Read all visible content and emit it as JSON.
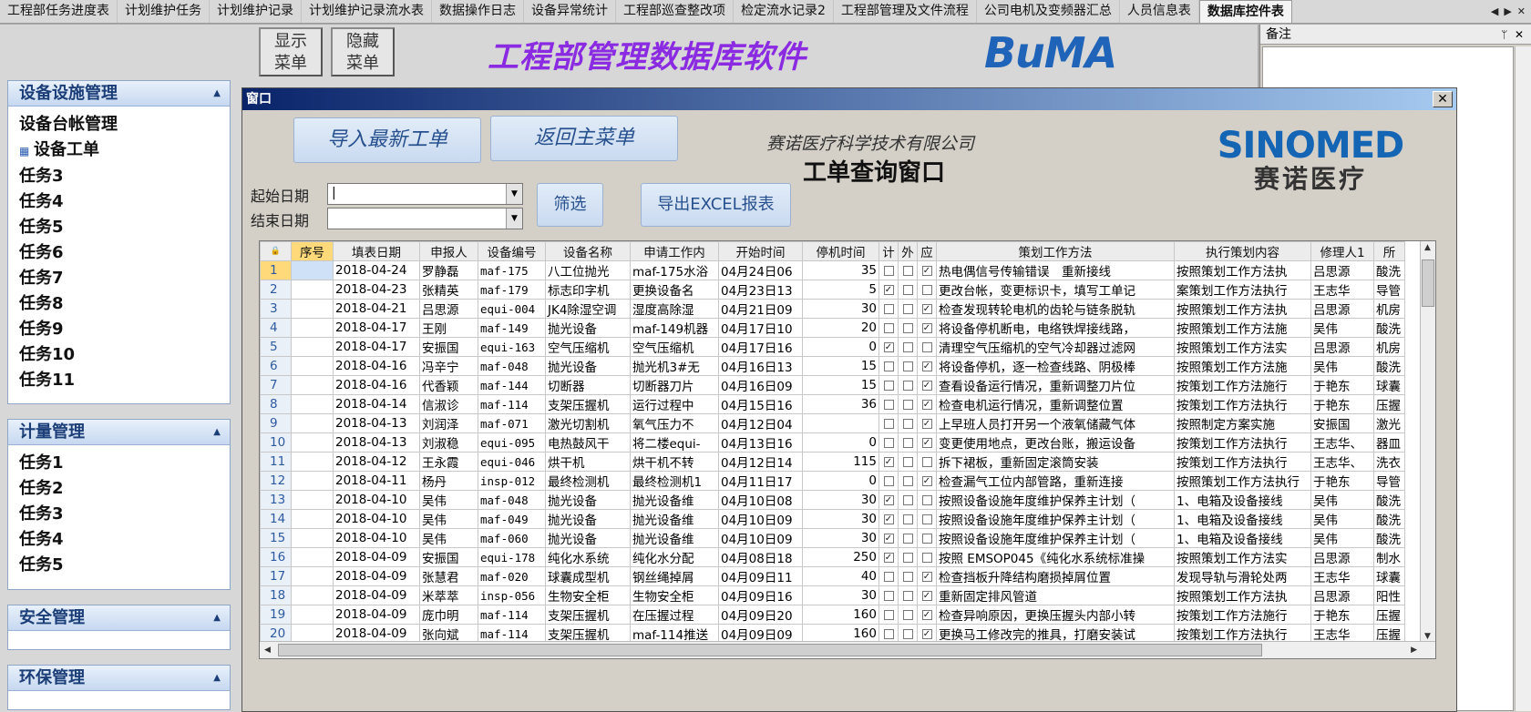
{
  "tabs": [
    {
      "label": "工程部任务进度表",
      "active": false
    },
    {
      "label": "计划维护任务",
      "active": false
    },
    {
      "label": "计划维护记录",
      "active": false
    },
    {
      "label": "计划维护记录流水表",
      "active": false
    },
    {
      "label": "数据操作日志",
      "active": false
    },
    {
      "label": "设备异常统计",
      "active": false
    },
    {
      "label": "工程部巡查整改项",
      "active": false
    },
    {
      "label": "检定流水记录2",
      "active": false
    },
    {
      "label": "工程部管理及文件流程",
      "active": false
    },
    {
      "label": "公司电机及变频器汇总",
      "active": false
    },
    {
      "label": "人员信息表",
      "active": false
    },
    {
      "label": "数据库控件表",
      "active": true
    }
  ],
  "top": {
    "show_menu": "显示\n菜单",
    "hide_menu": "隐藏\n菜单",
    "app_title": "工程部管理数据库软件",
    "buma_logo": "BuMA"
  },
  "sidebar": {
    "groups": [
      {
        "title": "设备设施管理",
        "items": [
          "设备台帐管理",
          "设备工单",
          "任务3",
          "任务4",
          "任务5",
          "任务6",
          "任务7",
          "任务8",
          "任务9",
          "任务10",
          "任务11"
        ]
      },
      {
        "title": "计量管理",
        "items": [
          "任务1",
          "任务2",
          "任务3",
          "任务4",
          "任务5"
        ]
      },
      {
        "title": "安全管理",
        "items": []
      },
      {
        "title": "环保管理",
        "items": []
      }
    ]
  },
  "notes": {
    "title": "备注",
    "pin": "ᛘ",
    "close": "✕"
  },
  "popup": {
    "title": "窗口",
    "close": "✕",
    "import_button": "导入最新工单",
    "back_button": "返回主菜单",
    "company": "赛诺医疗科学技术有限公司",
    "window_title": "工单查询窗口",
    "logo_en": "SINOMED",
    "logo_cn": "赛诺医疗",
    "start_label": "起始日期",
    "end_label": "结束日期",
    "start_value": "|",
    "end_value": "",
    "filter_button": "筛选",
    "export_button": "导出EXCEL报表"
  },
  "grid": {
    "columns": [
      "序号",
      "填表日期",
      "申报人",
      "设备编号",
      "设备名称",
      "申请工作内",
      "开始时间",
      "停机时间",
      "计",
      "外",
      "应",
      "策划工作方法",
      "执行策划内容",
      "修理人1",
      "所"
    ],
    "rows": [
      {
        "n": "1",
        "date": "2018-04-24",
        "person": "罗静磊",
        "code": "maf-175",
        "name": "八工位抛光",
        "req": "maf-175水浴",
        "start": "04月24日06",
        "stop": "35",
        "c1": false,
        "c2": false,
        "c3": true,
        "plan": "热电偶信号传输错误　重新接线",
        "exec": "按照策划工作方法执",
        "rep": "吕思源",
        "loc": "酸洗"
      },
      {
        "n": "2",
        "date": "2018-04-23",
        "person": "张精英",
        "code": "maf-179",
        "name": "标志印字机",
        "req": "更换设备名",
        "start": "04月23日13",
        "stop": "5",
        "c1": true,
        "c2": false,
        "c3": false,
        "plan": "更改台帐，变更标识卡，填写工单记",
        "exec": "案策划工作方法执行",
        "rep": "王志华",
        "loc": "导管"
      },
      {
        "n": "3",
        "date": "2018-04-21",
        "person": "吕思源",
        "code": "equi-004",
        "name": "JK4除湿空调",
        "req": "湿度高除湿",
        "start": "04月21日09",
        "stop": "30",
        "c1": false,
        "c2": false,
        "c3": true,
        "plan": "检查发现转轮电机的齿轮与链条脱轨",
        "exec": "按照策划工作方法执",
        "rep": "吕思源",
        "loc": "机房"
      },
      {
        "n": "4",
        "date": "2018-04-17",
        "person": "王刚",
        "code": "maf-149",
        "name": "抛光设备",
        "req": "maf-149机器",
        "start": "04月17日10",
        "stop": "20",
        "c1": false,
        "c2": false,
        "c3": true,
        "plan": "将设备停机断电，电络铁焊接线路，",
        "exec": "按照策划工作方法施",
        "rep": "吴伟",
        "loc": "酸洗"
      },
      {
        "n": "5",
        "date": "2018-04-17",
        "person": "安振国",
        "code": "equi-163",
        "name": "空气压缩机",
        "req": "空气压缩机",
        "start": "04月17日16",
        "stop": "0",
        "c1": true,
        "c2": false,
        "c3": false,
        "plan": "清理空气压缩机的空气冷却器过滤网",
        "exec": "按照策划工作方法实",
        "rep": "吕思源",
        "loc": "机房"
      },
      {
        "n": "6",
        "date": "2018-04-16",
        "person": "冯辛宁",
        "code": "maf-048",
        "name": "抛光设备",
        "req": "抛光机3#无",
        "start": "04月16日13",
        "stop": "15",
        "c1": false,
        "c2": false,
        "c3": true,
        "plan": "将设备停机，逐一检查线路、阴极棒",
        "exec": "按照策划工作方法施",
        "rep": "吴伟",
        "loc": "酸洗"
      },
      {
        "n": "7",
        "date": "2018-04-16",
        "person": "代香颖",
        "code": "maf-144",
        "name": "切断器",
        "req": "切断器刀片",
        "start": "04月16日09",
        "stop": "15",
        "c1": false,
        "c2": false,
        "c3": true,
        "plan": "查看设备运行情况，重新调整刀片位",
        "exec": "按策划工作方法施行",
        "rep": "于艳东",
        "loc": "球囊"
      },
      {
        "n": "8",
        "date": "2018-04-14",
        "person": "信淑诊",
        "code": "maf-114",
        "name": "支架压握机",
        "req": "运行过程中",
        "start": "04月15日16",
        "stop": "36",
        "c1": false,
        "c2": false,
        "c3": true,
        "plan": "检查电机运行情况，重新调整位置",
        "exec": "按策划工作方法执行",
        "rep": "于艳东",
        "loc": "压握"
      },
      {
        "n": "9",
        "date": "2018-04-13",
        "person": "刘润泽",
        "code": "maf-071",
        "name": "激光切割机",
        "req": "氧气压力不",
        "start": "04月12日04",
        "stop": "",
        "c1": false,
        "c2": false,
        "c3": true,
        "plan": "上早班人员打开另一个液氧储藏气体",
        "exec": "按照制定方案实施",
        "rep": "安振国",
        "loc": "激光"
      },
      {
        "n": "10",
        "date": "2018-04-13",
        "person": "刘淑稳",
        "code": "equi-095",
        "name": "电热鼓风干",
        "req": "将二楼equi-",
        "start": "04月13日16",
        "stop": "0",
        "c1": false,
        "c2": false,
        "c3": true,
        "plan": "变更使用地点，更改台账，搬运设备",
        "exec": "按策划工作方法执行",
        "rep": "王志华、",
        "loc": "器皿"
      },
      {
        "n": "11",
        "date": "2018-04-12",
        "person": "王永霞",
        "code": "equi-046",
        "name": "烘干机",
        "req": "烘干机不转",
        "start": "04月12日14",
        "stop": "115",
        "c1": true,
        "c2": false,
        "c3": false,
        "plan": "拆下裙板，重新固定滚筒安装",
        "exec": "按策划工作方法执行",
        "rep": "王志华、",
        "loc": "洗衣"
      },
      {
        "n": "12",
        "date": "2018-04-11",
        "person": "杨丹",
        "code": "insp-012",
        "name": "最终检测机",
        "req": "最终检测机1",
        "start": "04月11日17",
        "stop": "0",
        "c1": false,
        "c2": false,
        "c3": true,
        "plan": "检查漏气工位内部管路，重新连接",
        "exec": "按照策划工作方法执行",
        "rep": "于艳东",
        "loc": "导管"
      },
      {
        "n": "13",
        "date": "2018-04-10",
        "person": "吴伟",
        "code": "maf-048",
        "name": "抛光设备",
        "req": "抛光设备维",
        "start": "04月10日08",
        "stop": "30",
        "c1": true,
        "c2": false,
        "c3": false,
        "plan": "按照设备设施年度维护保养主计划（",
        "exec": "1、电箱及设备接线",
        "rep": "吴伟",
        "loc": "酸洗"
      },
      {
        "n": "14",
        "date": "2018-04-10",
        "person": "吴伟",
        "code": "maf-049",
        "name": "抛光设备",
        "req": "抛光设备维",
        "start": "04月10日09",
        "stop": "30",
        "c1": true,
        "c2": false,
        "c3": false,
        "plan": "按照设备设施年度维护保养主计划（",
        "exec": "1、电箱及设备接线",
        "rep": "吴伟",
        "loc": "酸洗"
      },
      {
        "n": "15",
        "date": "2018-04-10",
        "person": "吴伟",
        "code": "maf-060",
        "name": "抛光设备",
        "req": "抛光设备维",
        "start": "04月10日09",
        "stop": "30",
        "c1": true,
        "c2": false,
        "c3": false,
        "plan": "按照设备设施年度维护保养主计划（",
        "exec": "1、电箱及设备接线",
        "rep": "吴伟",
        "loc": "酸洗"
      },
      {
        "n": "16",
        "date": "2018-04-09",
        "person": "安振国",
        "code": "equi-178",
        "name": "纯化水系统",
        "req": "纯化水分配",
        "start": "04月08日18",
        "stop": "250",
        "c1": true,
        "c2": false,
        "c3": false,
        "plan": "按照 EMSOP045《纯化水系统标准操",
        "exec": "按照策划工作方法实",
        "rep": "吕思源",
        "loc": "制水"
      },
      {
        "n": "17",
        "date": "2018-04-09",
        "person": "张慧君",
        "code": "maf-020",
        "name": "球囊成型机",
        "req": "钢丝绳掉屑",
        "start": "04月09日11",
        "stop": "40",
        "c1": false,
        "c2": false,
        "c3": true,
        "plan": "检查挡板升降结构磨损掉屑位置",
        "exec": "发现导轨与滑轮处两",
        "rep": "王志华",
        "loc": "球囊"
      },
      {
        "n": "18",
        "date": "2018-04-09",
        "person": "米萃萃",
        "code": "insp-056",
        "name": "生物安全柜",
        "req": "生物安全柜",
        "start": "04月09日16",
        "stop": "30",
        "c1": false,
        "c2": false,
        "c3": true,
        "plan": "重新固定排风管道",
        "exec": "按照策划工作方法执",
        "rep": "吕思源",
        "loc": "阳性"
      },
      {
        "n": "19",
        "date": "2018-04-09",
        "person": "庞巾明",
        "code": "maf-114",
        "name": "支架压握机",
        "req": "在压握过程",
        "start": "04月09日20",
        "stop": "160",
        "c1": false,
        "c2": false,
        "c3": true,
        "plan": "检查异响原因，更换压握头内部小转",
        "exec": "按策划工作方法施行",
        "rep": "于艳东",
        "loc": "压握"
      },
      {
        "n": "20",
        "date": "2018-04-09",
        "person": "张向斌",
        "code": "maf-114",
        "name": "支架压握机",
        "req": "maf-114推送",
        "start": "04月09日09",
        "stop": "160",
        "c1": false,
        "c2": false,
        "c3": true,
        "plan": "更换马工修改完的推具，打磨安装试",
        "exec": "按策划工作方法执行",
        "rep": "王志华",
        "loc": "压握"
      }
    ]
  }
}
